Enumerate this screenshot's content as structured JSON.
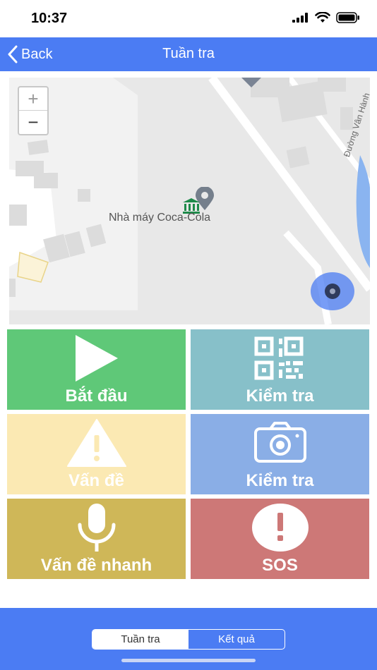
{
  "status": {
    "time": "10:37"
  },
  "nav": {
    "back_label": "Back",
    "title": "Tuần tra"
  },
  "map": {
    "poi_label": "Nhà máy Coca-Cola",
    "road_label": "Đường Vân Hành",
    "zoom_in": "+",
    "zoom_out": "−"
  },
  "tiles": [
    {
      "label": "Bắt đầu",
      "icon": "play-icon",
      "color": "#5fc878"
    },
    {
      "label": "Kiểm tra",
      "icon": "qr-code-icon",
      "color": "#87c0c9"
    },
    {
      "label": "Vấn đề",
      "icon": "warning-icon",
      "color": "#fbe9b3"
    },
    {
      "label": "Kiểm tra",
      "icon": "camera-icon",
      "color": "#8aaee6"
    },
    {
      "label": "Vấn đề nhanh",
      "icon": "microphone-icon",
      "color": "#cfb758"
    },
    {
      "label": "SOS",
      "icon": "alert-circle-icon",
      "color": "#cd7877"
    }
  ],
  "bottom_tabs": {
    "active": "Tuần tra",
    "inactive": "Kết quả"
  },
  "colors": {
    "accent": "#4b7cf3"
  }
}
